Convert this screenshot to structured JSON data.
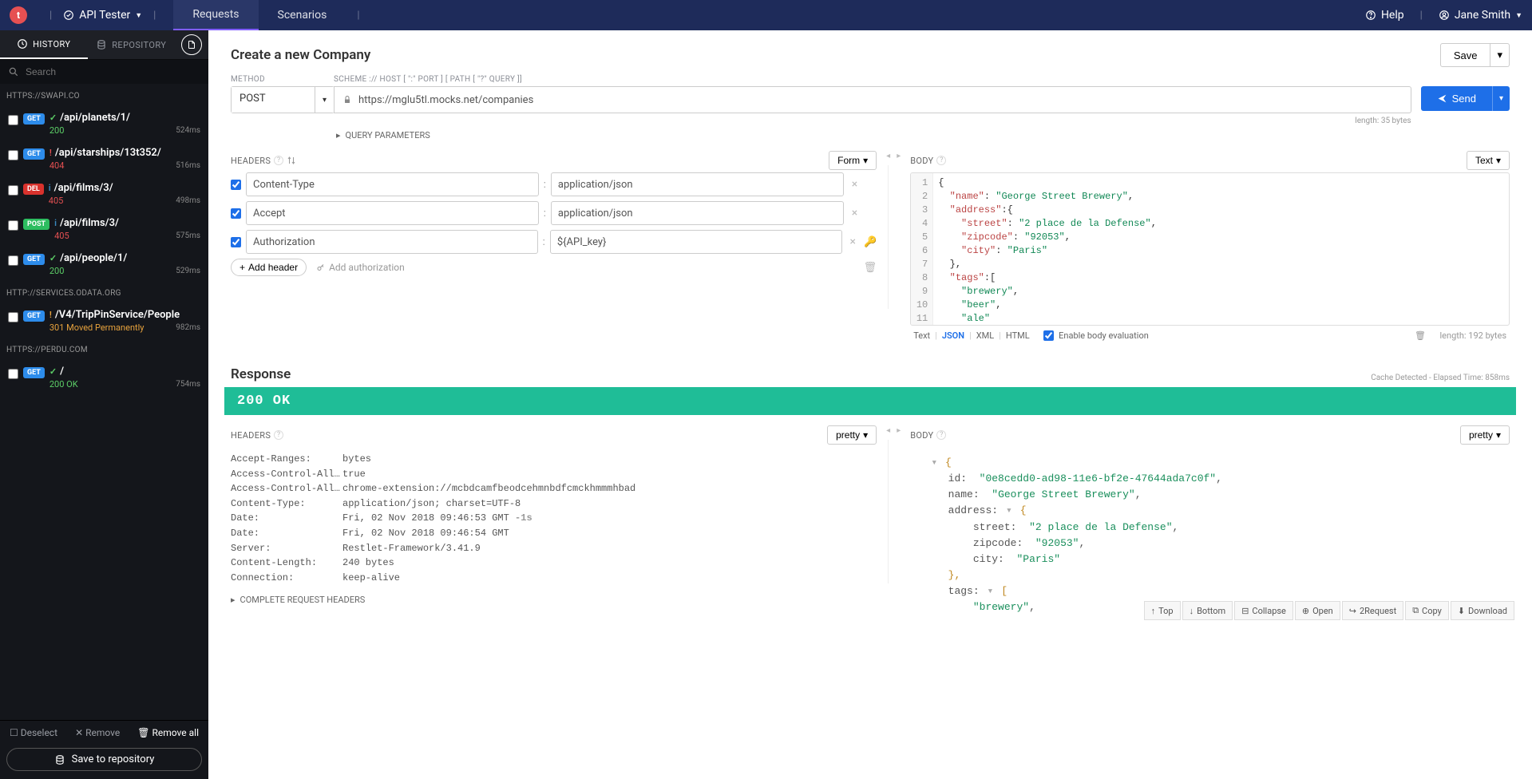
{
  "topbar": {
    "app_name": "API Tester",
    "tabs": {
      "requests": "Requests",
      "scenarios": "Scenarios"
    },
    "help": "Help",
    "user": "Jane Smith"
  },
  "sidebar": {
    "tabs": {
      "history": "HISTORY",
      "repository": "REPOSITORY"
    },
    "search_placeholder": "Search",
    "groups": [
      {
        "host": "HTTPS://SWAPI.CO",
        "items": [
          {
            "method": "GET",
            "path": "/api/planets/1/",
            "status": "200",
            "status_class": "s200",
            "stat_ico": "✓",
            "stat_cls": "ok-green",
            "time": "524ms"
          },
          {
            "method": "GET",
            "path": "/api/starships/13t352/",
            "status": "404",
            "status_class": "s404",
            "stat_ico": "!",
            "stat_cls": "err-red",
            "time": "516ms"
          },
          {
            "method": "DEL",
            "path": "/api/films/3/",
            "status": "405",
            "status_class": "s405",
            "stat_ico": "i",
            "stat_cls": "warn-blue",
            "time": "498ms"
          },
          {
            "method": "POST",
            "path": "/api/films/3/",
            "status": "405",
            "status_class": "s405",
            "stat_ico": "i",
            "stat_cls": "warn-blue",
            "time": "575ms"
          },
          {
            "method": "GET",
            "path": "/api/people/1/",
            "status": "200",
            "status_class": "s200",
            "stat_ico": "✓",
            "stat_cls": "ok-green",
            "time": "529ms"
          }
        ]
      },
      {
        "host": "HTTP://SERVICES.ODATA.ORG",
        "items": [
          {
            "method": "GET",
            "path": "/V4/TripPinService/People",
            "status": "301 Moved Permanently",
            "status_class": "s301",
            "stat_ico": "!",
            "stat_cls": "warn-orange",
            "time": "982ms"
          }
        ]
      },
      {
        "host": "HTTPS://PERDU.COM",
        "items": [
          {
            "method": "GET",
            "path": "/",
            "status": "200 OK",
            "status_class": "s200",
            "stat_ico": "✓",
            "stat_cls": "ok-green",
            "time": "754ms"
          }
        ]
      }
    ],
    "footer": {
      "deselect": "Deselect",
      "remove": "Remove",
      "remove_all": "Remove all",
      "save": "Save to repository"
    }
  },
  "request": {
    "title": "Create a new Company",
    "save_label": "Save",
    "method_label": "METHOD",
    "url_label": "SCHEME :// HOST [ \":\" PORT ] [ PATH [ \"?\" QUERY ]]",
    "method": "POST",
    "url": "https://mglu5tl.mocks.net/companies",
    "url_length": "length: 35 bytes",
    "send_label": "Send",
    "query_params_label": "QUERY PARAMETERS",
    "headers_label": "HEADERS",
    "form_toggle": "Form",
    "headers": [
      {
        "name": "Content-Type",
        "value": "application/json"
      },
      {
        "name": "Accept",
        "value": "application/json"
      },
      {
        "name": "Authorization",
        "value": "${API_key}"
      }
    ],
    "add_header": "Add header",
    "add_auth": "Add authorization",
    "body_label": "BODY",
    "body_toggle": "Text",
    "body_lines": [
      [
        {
          "t": "{",
          "c": "pun"
        }
      ],
      [
        {
          "t": "  ",
          "c": "pun"
        },
        {
          "t": "\"name\"",
          "c": "key"
        },
        {
          "t": ": ",
          "c": "pun"
        },
        {
          "t": "\"George Street Brewery\"",
          "c": "str"
        },
        {
          "t": ",",
          "c": "pun"
        }
      ],
      [
        {
          "t": "  ",
          "c": "pun"
        },
        {
          "t": "\"address\"",
          "c": "key"
        },
        {
          "t": ":{",
          "c": "pun"
        }
      ],
      [
        {
          "t": "    ",
          "c": "pun"
        },
        {
          "t": "\"street\"",
          "c": "key"
        },
        {
          "t": ": ",
          "c": "pun"
        },
        {
          "t": "\"2 place de la Defense\"",
          "c": "str"
        },
        {
          "t": ",",
          "c": "pun"
        }
      ],
      [
        {
          "t": "    ",
          "c": "pun"
        },
        {
          "t": "\"zipcode\"",
          "c": "key"
        },
        {
          "t": ": ",
          "c": "pun"
        },
        {
          "t": "\"92053\"",
          "c": "str"
        },
        {
          "t": ",",
          "c": "pun"
        }
      ],
      [
        {
          "t": "    ",
          "c": "pun"
        },
        {
          "t": "\"city\"",
          "c": "key"
        },
        {
          "t": ": ",
          "c": "pun"
        },
        {
          "t": "\"Paris\"",
          "c": "str"
        }
      ],
      [
        {
          "t": "  },",
          "c": "pun"
        }
      ],
      [
        {
          "t": "  ",
          "c": "pun"
        },
        {
          "t": "\"tags\"",
          "c": "key"
        },
        {
          "t": ":[",
          "c": "pun"
        }
      ],
      [
        {
          "t": "    ",
          "c": "pun"
        },
        {
          "t": "\"brewery\"",
          "c": "str"
        },
        {
          "t": ",",
          "c": "pun"
        }
      ],
      [
        {
          "t": "    ",
          "c": "pun"
        },
        {
          "t": "\"beer\"",
          "c": "str"
        },
        {
          "t": ",",
          "c": "pun"
        }
      ],
      [
        {
          "t": "    ",
          "c": "pun"
        },
        {
          "t": "\"ale\"",
          "c": "str"
        }
      ],
      [
        {
          "t": "  ]",
          "c": "pun"
        }
      ],
      [
        {
          "t": "}",
          "c": "pun"
        }
      ]
    ],
    "body_formats": {
      "text": "Text",
      "json": "JSON",
      "xml": "XML",
      "html": "HTML"
    },
    "enable_eval": "Enable body evaluation",
    "body_length": "length: 192 bytes"
  },
  "response": {
    "title": "Response",
    "meta": "Cache Detected - Elapsed Time: 858ms",
    "status": "200 OK",
    "headers_label": "HEADERS",
    "pretty_label": "pretty",
    "headers": [
      {
        "name": "Accept-Ranges:",
        "value": "bytes"
      },
      {
        "name": "Access-Control-Allow-C…",
        "value": "true"
      },
      {
        "name": "Access-Control-Allow-O…",
        "value": "chrome-extension://mcbdcamfbeodcehmnbdfcmckhmmmhbad"
      },
      {
        "name": "Content-Type:",
        "value": "application/json; charset=UTF-8"
      },
      {
        "name": "Date:",
        "value": "Fri, 02 Nov 2018 09:46:53 GMT",
        "ago": "-1s"
      },
      {
        "name": "Date:",
        "value": "Fri, 02 Nov 2018 09:46:54 GMT"
      },
      {
        "name": "Server:",
        "value": "Restlet-Framework/3.41.9"
      },
      {
        "name": "Content-Length:",
        "value": "240 bytes"
      },
      {
        "name": "Connection:",
        "value": "keep-alive"
      }
    ],
    "complete_headers": "COMPLETE REQUEST HEADERS",
    "body_label": "BODY",
    "body_json": {
      "id": "\"0e8cedd0-ad98-11e6-bf2e-47644ada7c0f\"",
      "name": "\"George Street Brewery\"",
      "address_key": "address:",
      "street": "\"2 place de la Defense\"",
      "zipcode": "\"92053\"",
      "city": "\"Paris\"",
      "tags_key": "tags:",
      "brewery": "\"brewery\""
    },
    "actions": {
      "top": "Top",
      "bottom": "Bottom",
      "collapse": "Collapse",
      "open": "Open",
      "request": "2Request",
      "copy": "Copy",
      "download": "Download"
    }
  }
}
